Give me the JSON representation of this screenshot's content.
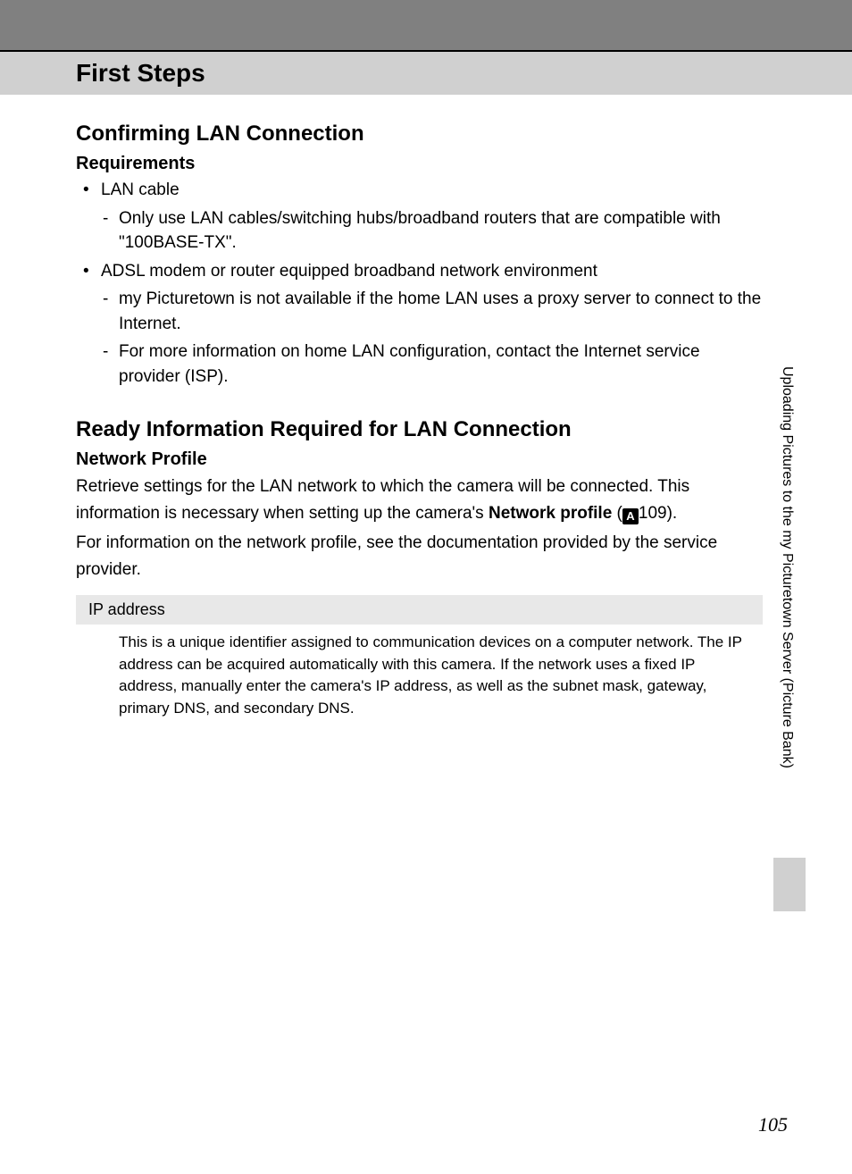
{
  "header": {
    "title": "First Steps"
  },
  "section1": {
    "heading": "Confirming LAN Connection",
    "sub": "Requirements",
    "bullet1": "LAN cable",
    "dash1": "Only use LAN cables/switching hubs/broadband routers that are compatible with \"100BASE-TX\".",
    "bullet2": "ADSL modem or router equipped broadband network environment",
    "dash2": "my Picturetown is not available if the home LAN uses a proxy server to connect to the Internet.",
    "dash3": "For more information on home LAN configuration, contact the Internet service provider (ISP)."
  },
  "section2": {
    "heading": "Ready Information Required for LAN Connection",
    "sub": "Network Profile",
    "para_pre": "Retrieve settings for the LAN network to which the camera will be connected. This information is necessary when setting up the camera's ",
    "bold": "Network profile",
    "ref_open": " (",
    "ref_icon": "A",
    "ref_num": "109).",
    "para_post": "For information on the network profile, see the documentation provided by the service provider.",
    "table_header": "IP address",
    "table_body": "This is a unique identifier assigned to communication devices on a computer network. The IP address can be acquired automatically with this camera. If the network uses a fixed IP address, manually enter the camera's IP address, as well as the subnet mask, gateway, primary DNS, and secondary DNS."
  },
  "side": {
    "text": "Uploading Pictures to the my Picturetown Server (Picture Bank)"
  },
  "page_number": "105"
}
